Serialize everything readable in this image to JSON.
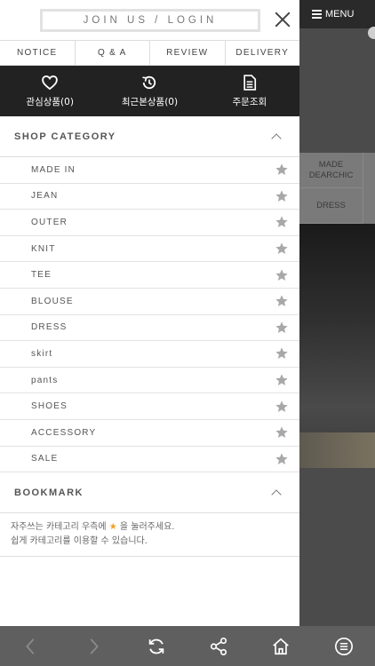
{
  "drawer": {
    "join_label": "JOIN US / LOGIN",
    "tabs": [
      {
        "label": "NOTICE"
      },
      {
        "label": "Q & A"
      },
      {
        "label": "REVIEW"
      },
      {
        "label": "DELIVERY"
      }
    ],
    "quick": [
      {
        "label": "관심상품(0)",
        "icon": "heart-icon"
      },
      {
        "label": "최근본상품(0)",
        "icon": "history-icon"
      },
      {
        "label": "주문조회",
        "icon": "document-icon"
      }
    ],
    "category_title": "SHOP CATEGORY",
    "categories": [
      {
        "label": "MADE IN"
      },
      {
        "label": "JEAN"
      },
      {
        "label": "OUTER"
      },
      {
        "label": "KNIT"
      },
      {
        "label": "TEE"
      },
      {
        "label": "BLOUSE"
      },
      {
        "label": "DRESS"
      },
      {
        "label": "skirt"
      },
      {
        "label": "pants"
      },
      {
        "label": "SHOES"
      },
      {
        "label": "ACCESSORY"
      },
      {
        "label": "SALE"
      }
    ],
    "bookmark_title": "BOOKMARK",
    "bookmark_line1_a": "자주쓰는 카테고리 우측에",
    "bookmark_line1_b": "을 눌러주세요.",
    "bookmark_line2": "쉽게 카테고리를 이용할 수 있습니다."
  },
  "background": {
    "menu_label": "MENU",
    "cells": [
      "MADE DEARCHIC",
      "DRESS"
    ]
  },
  "colors": {
    "dark_bar": "#222222",
    "star_gray": "#a8a8a8",
    "star_gold": "#f0a020"
  }
}
